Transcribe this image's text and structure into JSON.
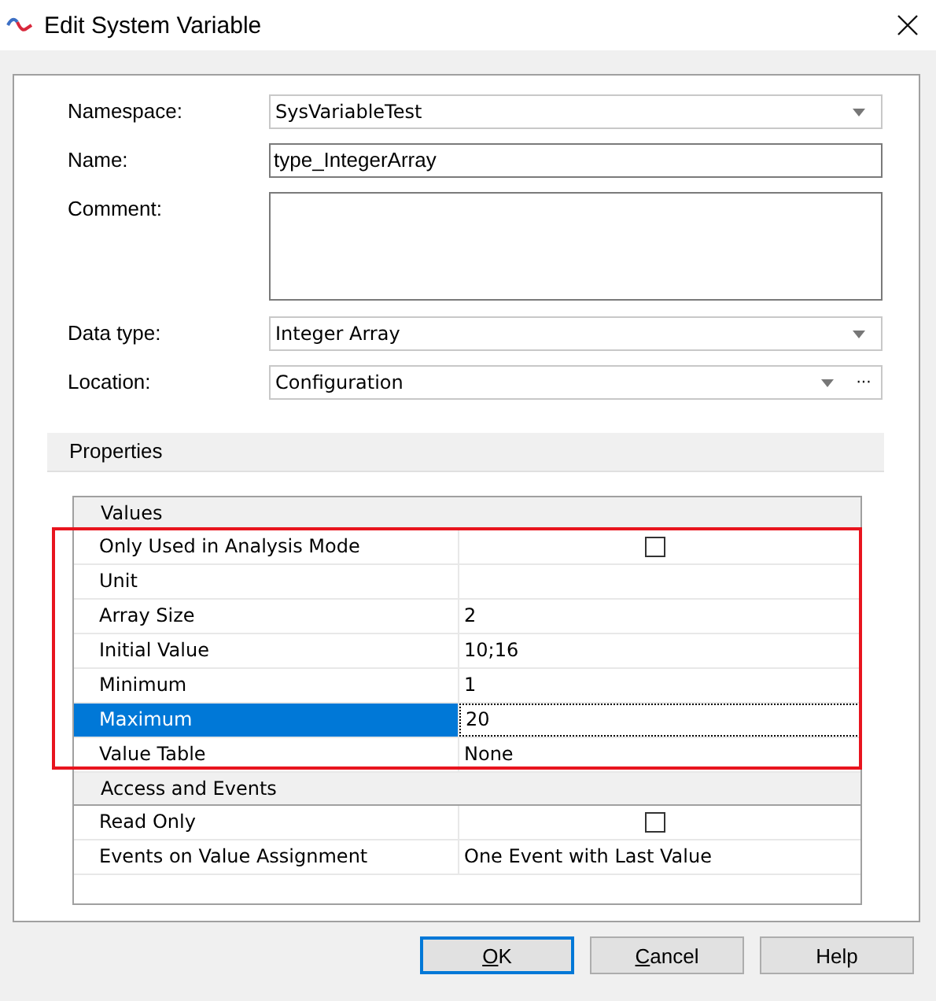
{
  "window": {
    "title": "Edit System Variable"
  },
  "fields": [
    {
      "label": "Namespace:",
      "kind": "dropdown",
      "value": "SysVariableTest"
    },
    {
      "label": "Name:",
      "kind": "text",
      "value": "type_IntegerArray"
    },
    {
      "label": "Comment:",
      "kind": "multiline"
    },
    {
      "label": "Data type:",
      "kind": "dropdown",
      "value": "Integer Array"
    },
    {
      "label": "Location:",
      "kind": "dropdown-browse",
      "value": "Configuration",
      "browse": "···"
    }
  ],
  "properties": {
    "title": "Properties",
    "categories": [
      {
        "name": "Values",
        "rows": [
          {
            "name": "Only Used in Analysis Mode",
            "kind": "check",
            "checked": false,
            "selected": false
          },
          {
            "name": "Unit",
            "kind": "text",
            "selected": false
          },
          {
            "name": "Array Size",
            "kind": "text",
            "value": "2",
            "selected": false
          },
          {
            "name": "Initial Value",
            "kind": "text",
            "value": "10;16",
            "selected": false
          },
          {
            "name": "Minimum",
            "kind": "text",
            "value": "1",
            "selected": false
          },
          {
            "name": "Maximum",
            "kind": "text",
            "value": "20",
            "selected": true
          },
          {
            "name": "Value Table",
            "kind": "text",
            "value": "None",
            "selected": false
          }
        ]
      },
      {
        "name": "Access and Events",
        "rows": [
          {
            "name": "Read Only",
            "kind": "check",
            "checked": false,
            "selected": false
          },
          {
            "name": "Events on Value Assignment",
            "kind": "text",
            "value": "One Event with Last Value",
            "selected": false
          }
        ]
      }
    ]
  },
  "buttons": [
    {
      "label": "OK",
      "default": true,
      "mnemonic": true
    },
    {
      "label": "Cancel",
      "default": false,
      "mnemonic": true
    },
    {
      "label": "Help",
      "default": false,
      "mnemonic": false
    }
  ]
}
